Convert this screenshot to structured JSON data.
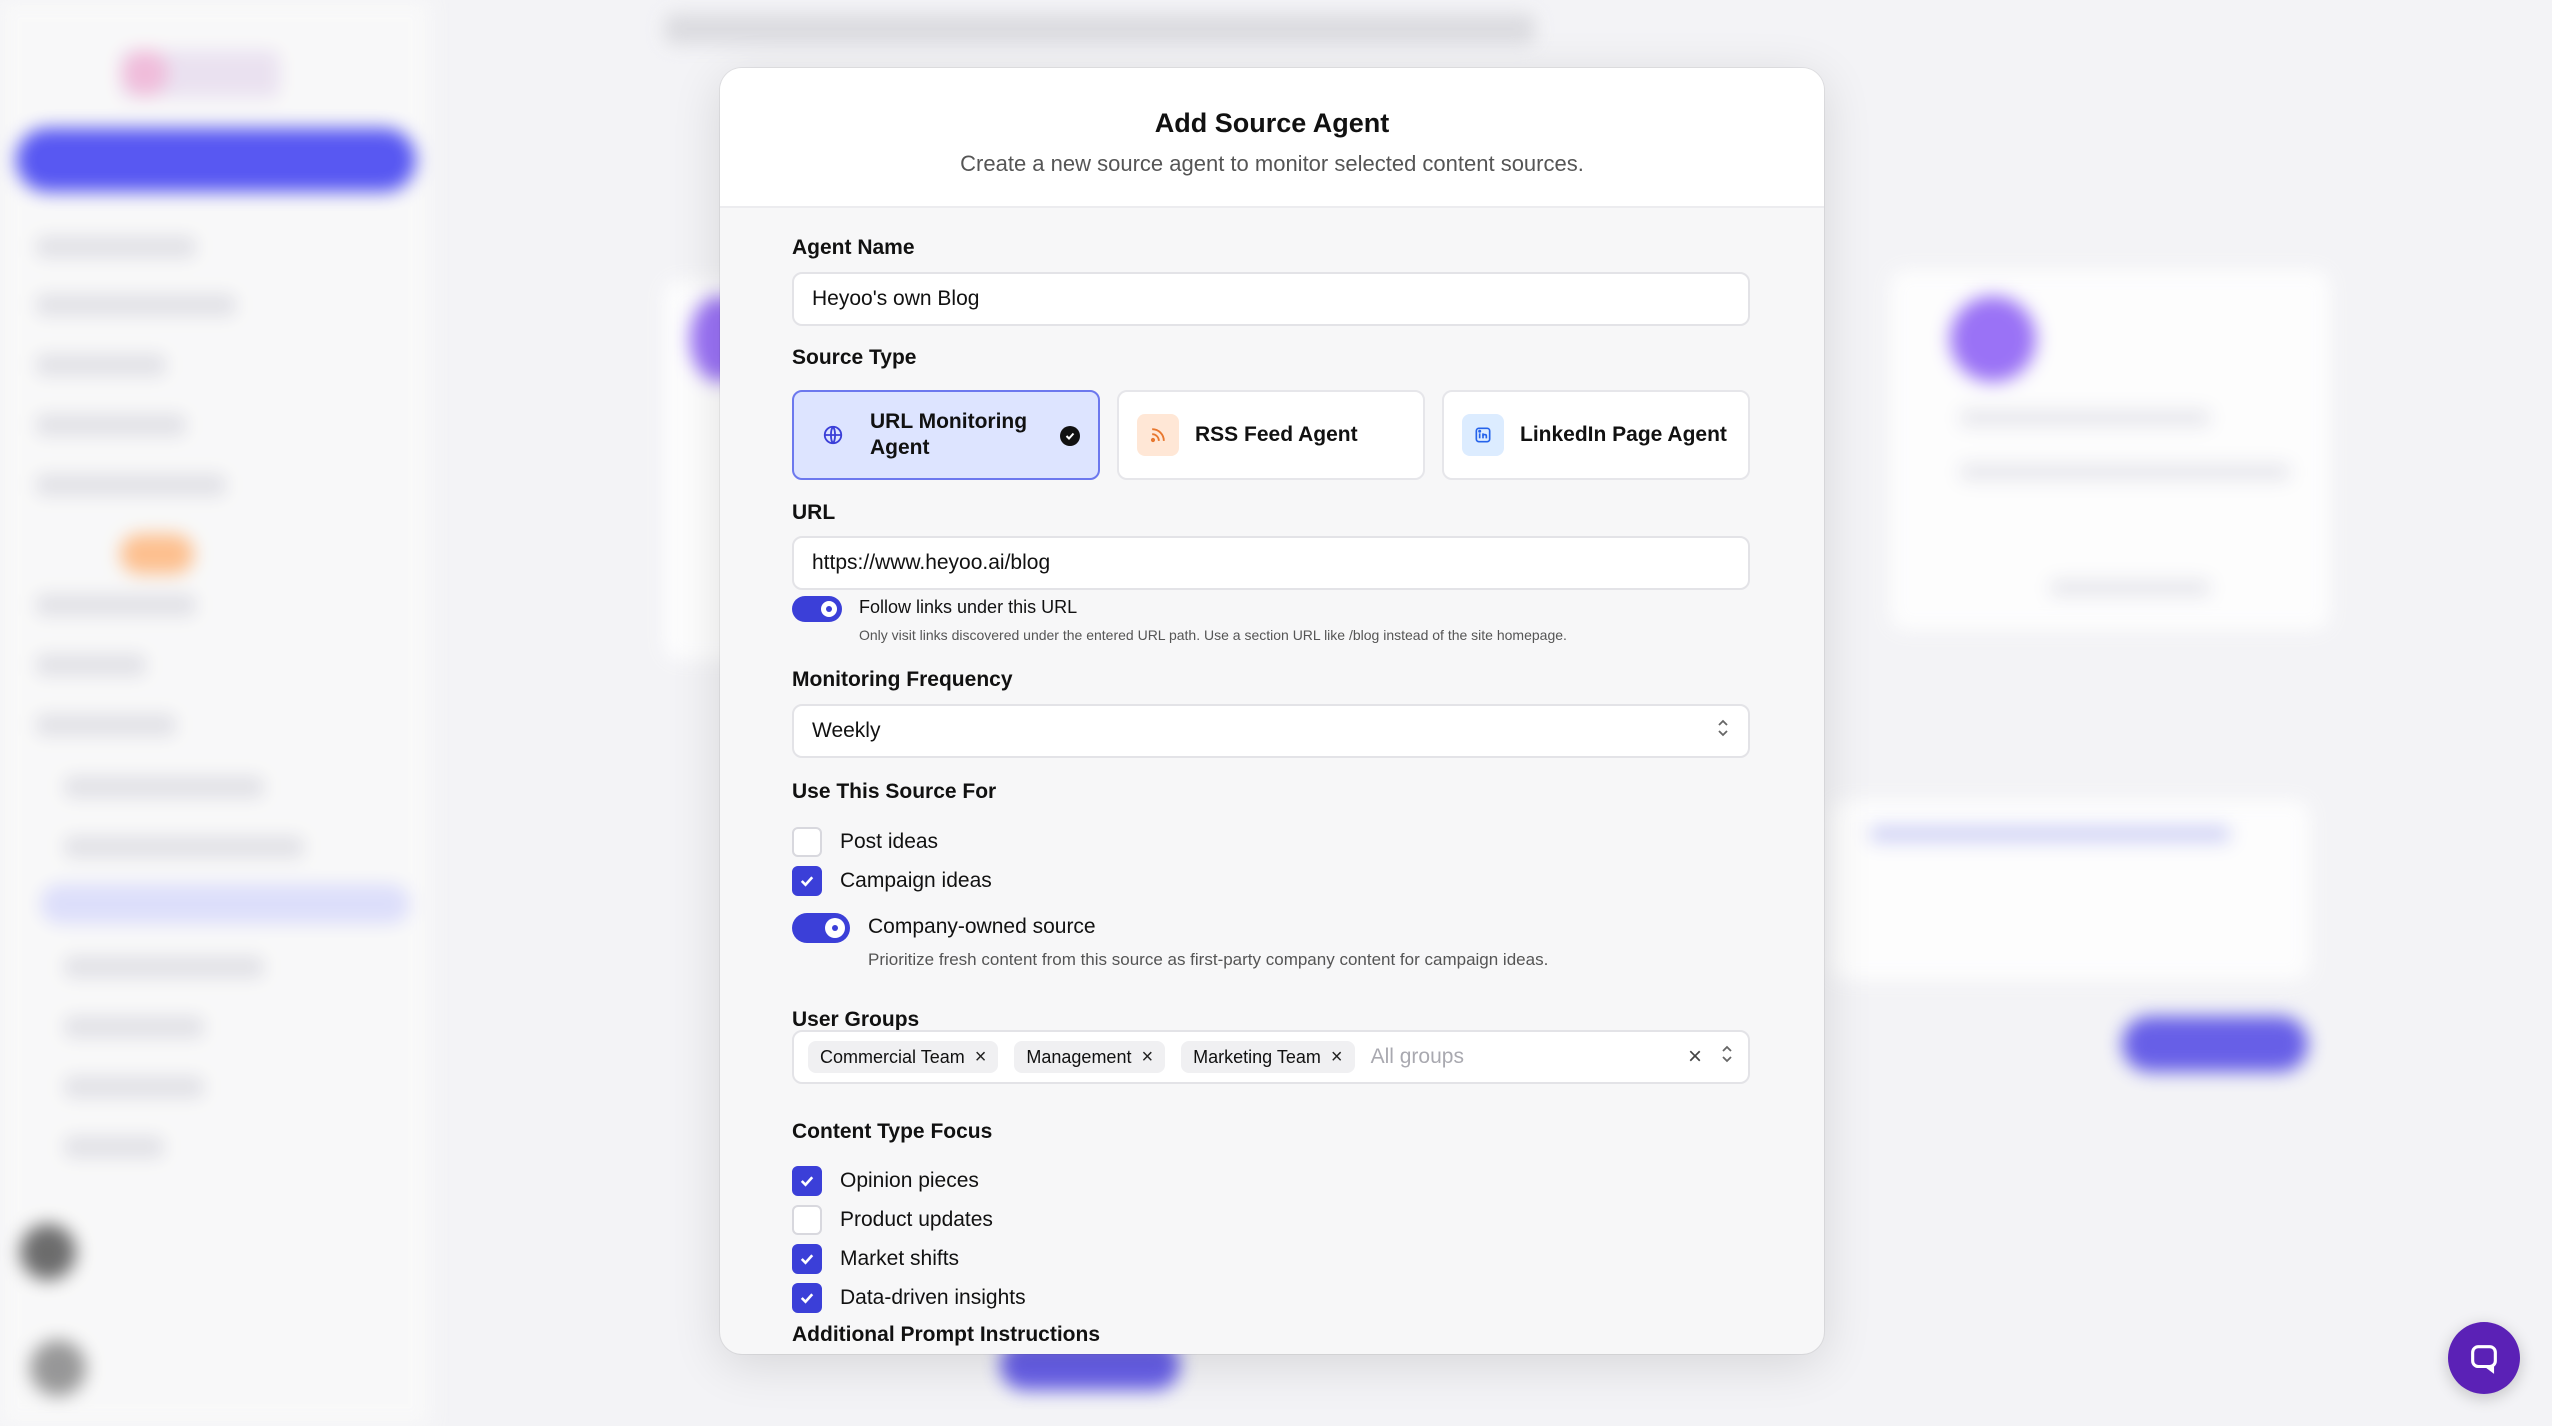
{
  "modal": {
    "title": "Add Source Agent",
    "subtitle": "Create a new source agent to monitor selected content sources."
  },
  "form": {
    "agent_name": {
      "label": "Agent Name",
      "value": "Heyoo's own Blog"
    },
    "source_type": {
      "label": "Source Type",
      "options": [
        {
          "label": "URL Monitoring Agent",
          "icon": "globe-icon",
          "selected": true
        },
        {
          "label": "RSS Feed Agent",
          "icon": "rss-icon",
          "selected": false
        },
        {
          "label": "LinkedIn Page Agent",
          "icon": "linkedin-icon",
          "selected": false
        }
      ]
    },
    "url": {
      "label": "URL",
      "value": "https://www.heyoo.ai/blog",
      "follow_links": {
        "label": "Follow links under this URL",
        "enabled": true,
        "help": "Only visit links discovered under the entered URL path. Use a section URL like /blog instead of the site homepage."
      }
    },
    "monitoring_frequency": {
      "label": "Monitoring Frequency",
      "value": "Weekly"
    },
    "use_for": {
      "label": "Use This Source For",
      "options": [
        {
          "label": "Post ideas",
          "checked": false
        },
        {
          "label": "Campaign ideas",
          "checked": true
        }
      ],
      "company_owned": {
        "label": "Company-owned source",
        "enabled": true,
        "help": "Prioritize fresh content from this source as first-party company content for campaign ideas."
      }
    },
    "user_groups": {
      "label": "User Groups",
      "tags": [
        "Commercial Team",
        "Management",
        "Marketing Team"
      ],
      "placeholder": "All groups"
    },
    "content_type_focus": {
      "label": "Content Type Focus",
      "options": [
        {
          "label": "Opinion pieces",
          "checked": true
        },
        {
          "label": "Product updates",
          "checked": false
        },
        {
          "label": "Market shifts",
          "checked": true
        },
        {
          "label": "Data-driven insights",
          "checked": true
        }
      ]
    },
    "additional_prompt": {
      "label": "Additional Prompt Instructions"
    }
  },
  "colors": {
    "accent": "#3b3fd8",
    "selected_card_bg": "#dde4ff",
    "chat_fab": "#5b21b6"
  }
}
